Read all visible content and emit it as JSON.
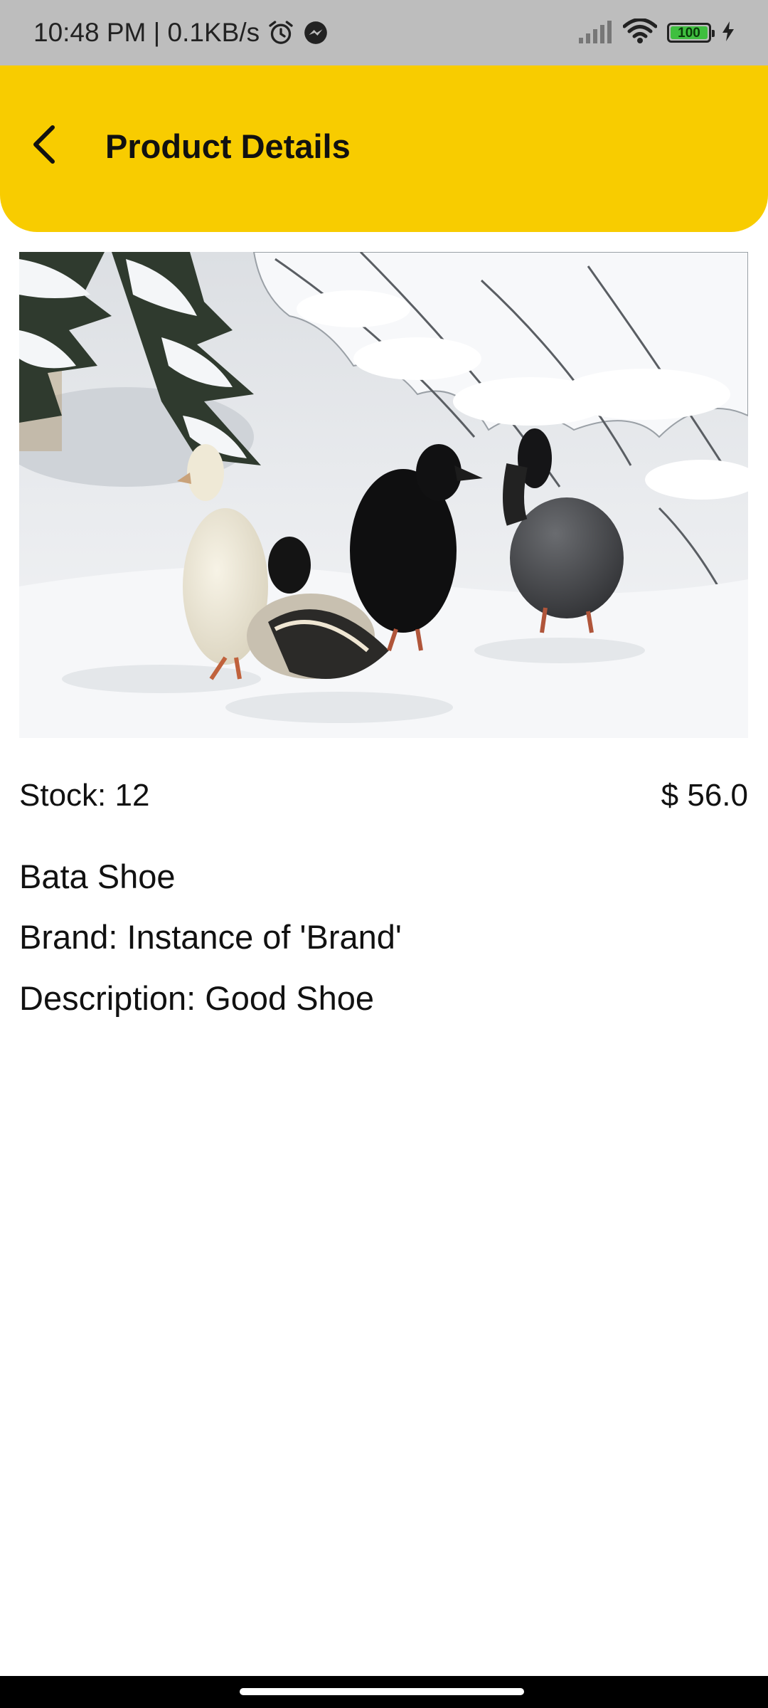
{
  "status_bar": {
    "time_speed": "10:48 PM | 0.1KB/s",
    "battery_level": "100",
    "icons": [
      "alarm-icon",
      "messenger-icon",
      "signal-icon",
      "wifi-icon",
      "battery-icon",
      "charging-icon"
    ]
  },
  "app_bar": {
    "title": "Product Details",
    "back_icon": "chevron-left-icon",
    "background_color": "#f8cc00"
  },
  "product": {
    "stock_text": "Stock: 12",
    "price_text": "$ 56.0",
    "name": "Bata Shoe",
    "brand_text": "Brand: Instance of 'Brand'",
    "description_text": "Description: Good Shoe"
  }
}
